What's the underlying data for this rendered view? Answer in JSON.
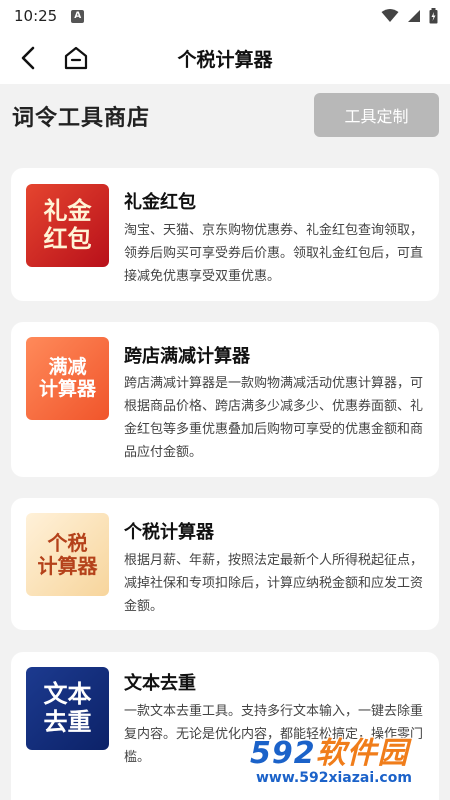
{
  "status_bar": {
    "time": "10:25",
    "notification_icon": "A",
    "icons": [
      "wifi-icon",
      "signal-icon",
      "battery-icon"
    ]
  },
  "app_bar": {
    "title": "个税计算器",
    "back_icon": "chevron-left-icon",
    "home_icon": "home-icon"
  },
  "shop": {
    "title": "词令工具商店",
    "custom_button": "工具定制"
  },
  "tools": [
    {
      "icon_text": [
        "礼金",
        "红包"
      ],
      "title": "礼金红包",
      "description": "淘宝、天猫、京东购物优惠券、礼金红包查询领取，领券后购买可享受券后价惠。领取礼金红包后，可直接减免优惠享受双重优惠。"
    },
    {
      "icon_text": [
        "满减",
        "计算器"
      ],
      "title": "跨店满减计算器",
      "description": "跨店满减计算器是一款购物满减活动优惠计算器，可根据商品价格、跨店满多少减多少、优惠券面额、礼金红包等多重优惠叠加后购物可享受的优惠金额和商品应付金额。"
    },
    {
      "icon_text": [
        "个税",
        "计算器"
      ],
      "title": "个税计算器",
      "description": "根据月薪、年薪，按照法定最新个人所得税起征点，减掉社保和专项扣除后，计算应纳税金额和应发工资金额。"
    },
    {
      "icon_text": [
        "文本",
        "去重"
      ],
      "title": "文本去重",
      "description": "一款文本去重工具。支持多行文本输入，一键去除重复内容。无论是优化内容，都能轻松搞定，操作零门槛。"
    }
  ],
  "watermark": {
    "logo_number": "592",
    "logo_text": "软件园",
    "url": "www.592xiazai.com"
  },
  "colors": {
    "custom_button_bg": "#b8b8b8",
    "page_bg": "#f2f2f2",
    "card_bg": "#ffffff",
    "watermark_blue": "#1b62c9",
    "watermark_orange": "#f07d1a"
  }
}
